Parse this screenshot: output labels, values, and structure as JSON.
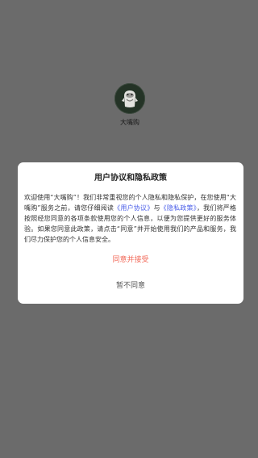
{
  "app": {
    "name": "大嘴购",
    "icon": "app-logo-icon"
  },
  "dialog": {
    "title": "用户协议和隐私政策",
    "body": {
      "part1": "欢迎使用“大嘴购”！我们非常重视您的个人隐私和隐私保护，在您使用“大嘴购”服务之前，请您仔细阅读",
      "user_agreement_link": "《用户协议》",
      "connector": "与",
      "privacy_policy_link": "《隐私政策》",
      "part2": "，我们将严格按照经您同意的各项条款使用您的个人信息，以便为您提供更好的服务体验。如果您同意此政策，请点击“同意”并开始使用我们的产品和服务，我们尽力保护您的个人信息安全。"
    },
    "agree_label": "同意并接受",
    "decline_label": "暂不同意"
  },
  "colors": {
    "overlay": "#6b6b6b",
    "link": "#4a5ee8",
    "agree": "#f26b5b",
    "decline": "#555555"
  }
}
